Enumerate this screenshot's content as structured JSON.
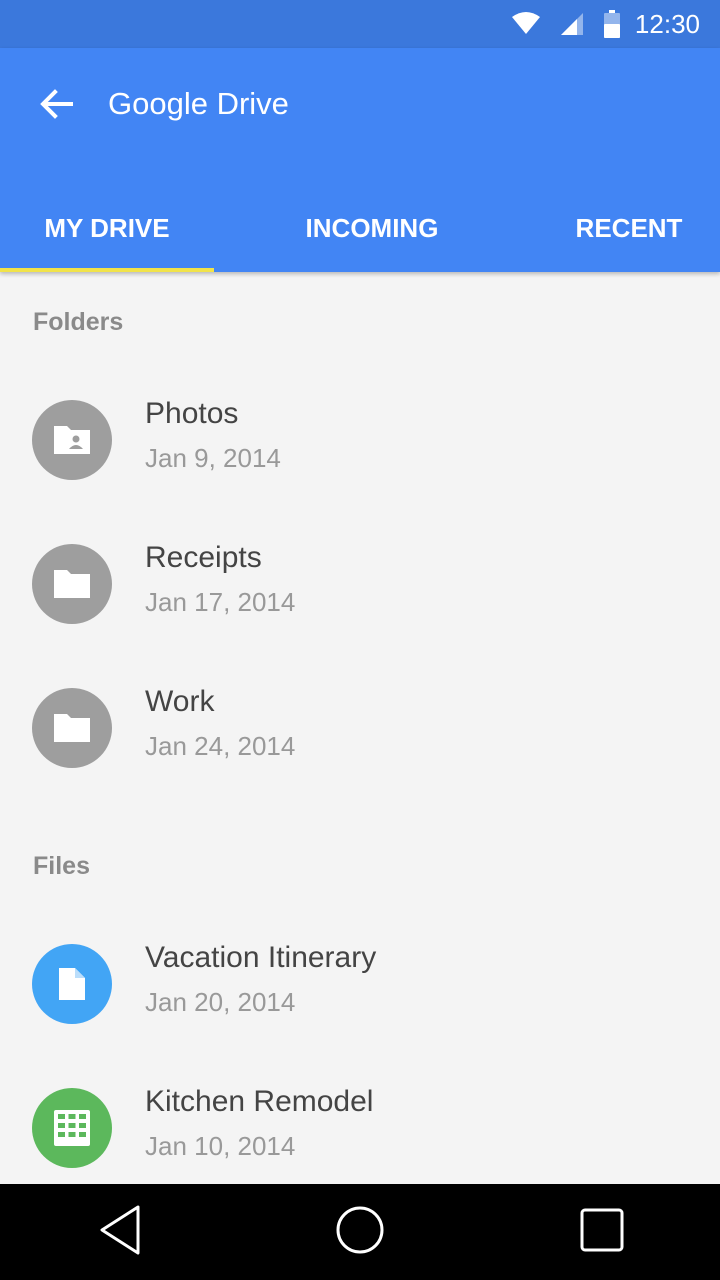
{
  "status_bar": {
    "time": "12:30",
    "icons": [
      "wifi-icon",
      "signal-icon",
      "battery-icon"
    ]
  },
  "app_bar": {
    "title": "Google Drive",
    "back_icon": "arrow-back-icon"
  },
  "tabs": [
    {
      "label": "MY DRIVE",
      "selected": true
    },
    {
      "label": "INCOMING",
      "selected": false
    },
    {
      "label": "RECENT",
      "selected": false
    }
  ],
  "sections": {
    "folders": {
      "header": "Folders",
      "items": [
        {
          "name": "Photos",
          "date": "Jan 9, 2014",
          "icon": "shared-folder-icon"
        },
        {
          "name": "Receipts",
          "date": "Jan 17, 2014",
          "icon": "folder-icon"
        },
        {
          "name": "Work",
          "date": "Jan 24, 2014",
          "icon": "folder-icon"
        }
      ]
    },
    "files": {
      "header": "Files",
      "items": [
        {
          "name": "Vacation Itinerary",
          "date": "Jan 20, 2014",
          "icon": "document-icon"
        },
        {
          "name": "Kitchen Remodel",
          "date": "Jan 10, 2014",
          "icon": "spreadsheet-icon"
        }
      ]
    }
  },
  "nav_bar": {
    "buttons": [
      "back-triangle-icon",
      "home-circle-icon",
      "recents-square-icon"
    ]
  },
  "colors": {
    "status_bar": "#3b78dc",
    "app_bar": "#4285f4",
    "tab_indicator": "#f1e34a",
    "folder_avatar": "#9e9e9e",
    "document_avatar": "#42a5f5",
    "spreadsheet_avatar": "#5cb85c"
  }
}
